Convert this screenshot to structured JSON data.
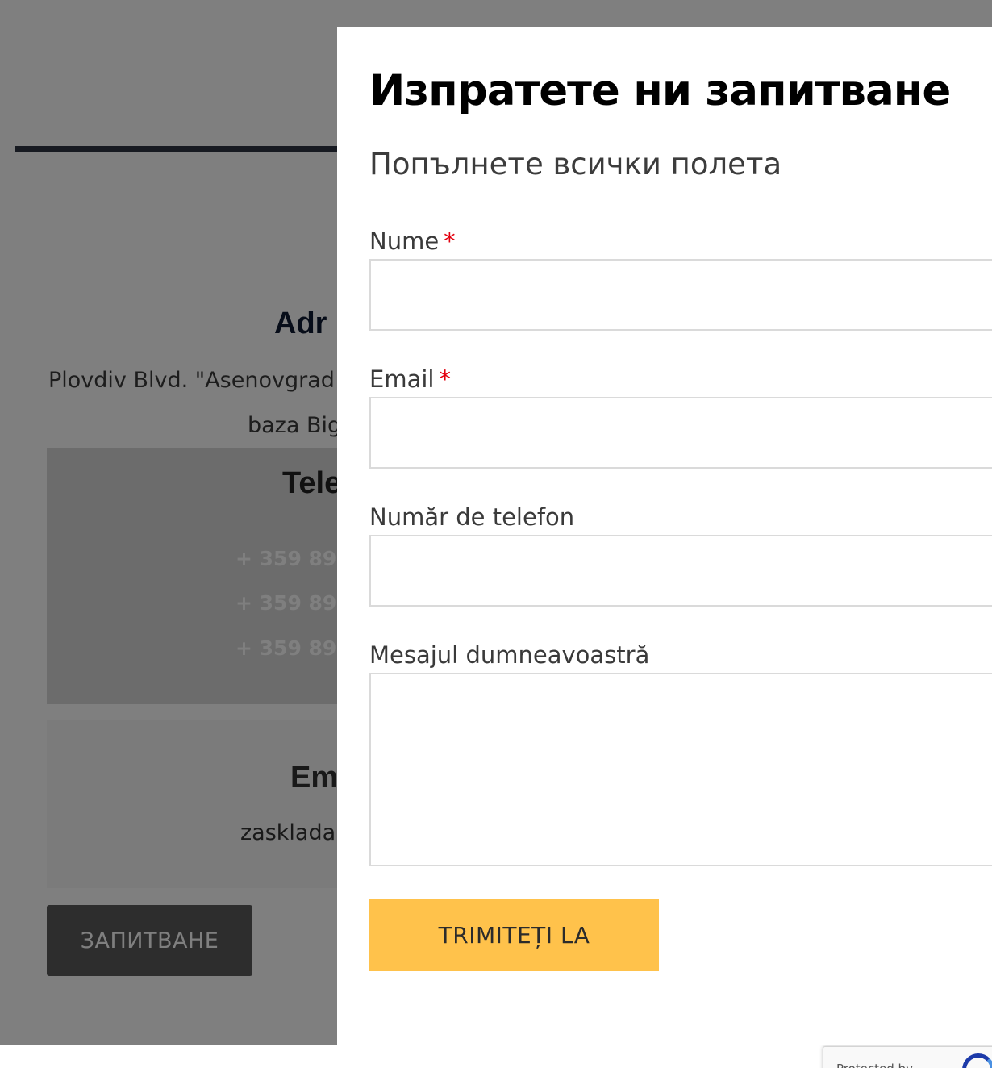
{
  "background": {
    "address": {
      "heading": "Adr",
      "line1": "Plovdiv Blvd. \"Asenovgrad",
      "line2": "baza Big"
    },
    "phones": {
      "heading": "Tele",
      "numbers": [
        "+ 359 89",
        "+ 359 89",
        "+ 359 89"
      ]
    },
    "email": {
      "heading": "Em",
      "value": "zasklada"
    },
    "inquiry_button": "ЗАПИТВАНЕ",
    "recaptcha": {
      "text": "Protected by"
    }
  },
  "modal": {
    "title": "Изпратете ни запитване",
    "subtitle": "Попълнете всички полета",
    "fields": {
      "name": {
        "label": "Nume",
        "required": "*",
        "value": ""
      },
      "email": {
        "label": "Email",
        "required": "*",
        "value": ""
      },
      "phone": {
        "label": "Număr de telefon",
        "value": ""
      },
      "message": {
        "label": "Mesajul dumneavoastră",
        "value": ""
      }
    },
    "submit_label": "TRIMITEȚI LA"
  },
  "colors": {
    "accent": "#ffc24b",
    "required": "#e3000f",
    "overlay": "rgba(0,0,0,0.5)"
  }
}
